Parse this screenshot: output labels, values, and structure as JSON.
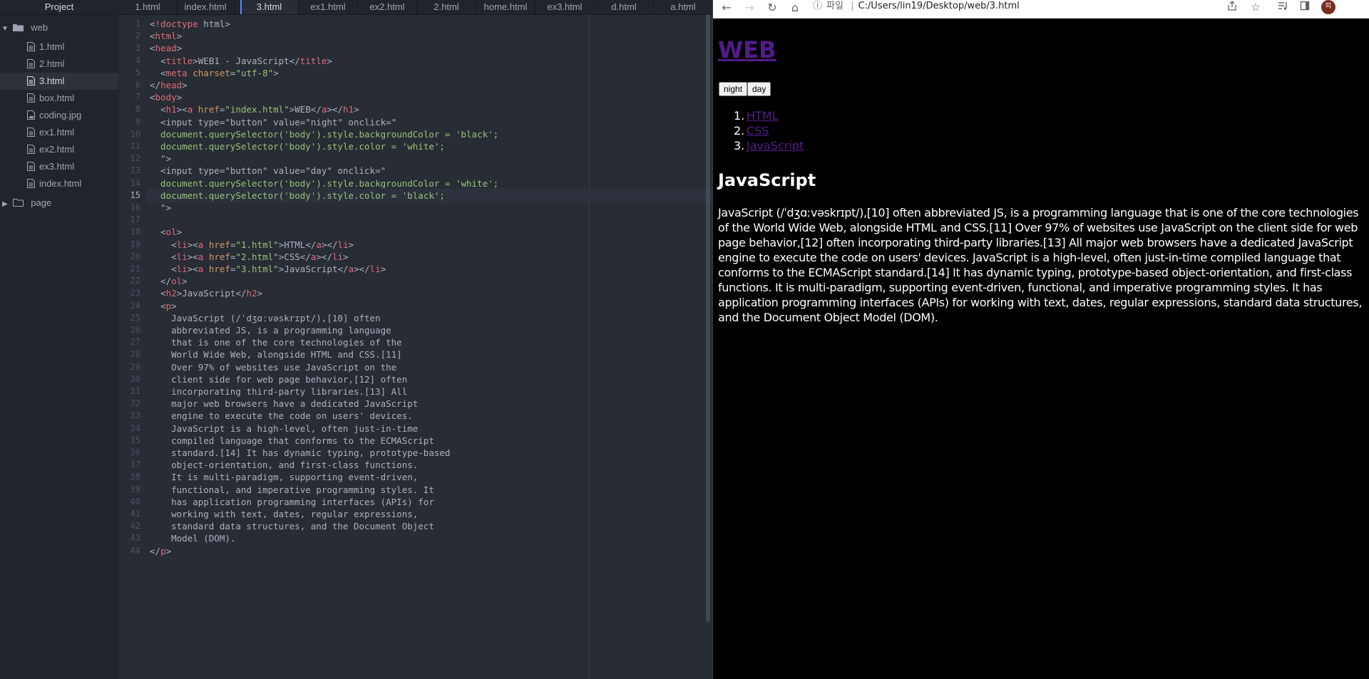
{
  "sidebar": {
    "header": "Project",
    "tree": [
      {
        "label": "web",
        "kind": "folder",
        "expanded": true
      },
      {
        "label": "1.html",
        "kind": "file"
      },
      {
        "label": "2.html",
        "kind": "file"
      },
      {
        "label": "3.html",
        "kind": "file",
        "selected": true
      },
      {
        "label": "box.html",
        "kind": "file"
      },
      {
        "label": "coding.jpg",
        "kind": "image"
      },
      {
        "label": "ex1.html",
        "kind": "file"
      },
      {
        "label": "ex2.html",
        "kind": "file"
      },
      {
        "label": "ex3.html",
        "kind": "file"
      },
      {
        "label": "index.html",
        "kind": "file"
      },
      {
        "label": "page",
        "kind": "folder",
        "expanded": false
      }
    ]
  },
  "editor": {
    "tabs": [
      {
        "label": "1.html"
      },
      {
        "label": "index.html"
      },
      {
        "label": "3.html",
        "active": true
      },
      {
        "label": "ex1.html"
      },
      {
        "label": "ex2.html"
      },
      {
        "label": "2.html"
      },
      {
        "label": "home.html"
      },
      {
        "label": "ex3.html"
      },
      {
        "label": "d.html"
      },
      {
        "label": "a.html"
      }
    ],
    "current_line": 15,
    "lines": [
      "<!doctype html>",
      "<html>",
      "<head>",
      "  <title>WEB1 - JavaScript</title>",
      "  <meta charset=\"utf-8\">",
      "</head>",
      "<body>",
      "  <h1><a href=\"index.html\">WEB</a></h1>",
      "  <input type=\"button\" value=\"night\" onclick=\"",
      "  document.querySelector('body').style.backgroundColor = 'black';",
      "  document.querySelector('body').style.color = 'white';",
      "  \">",
      "  <input type=\"button\" value=\"day\" onclick=\"",
      "  document.querySelector('body').style.backgroundColor = 'white';",
      "  document.querySelector('body').style.color = 'black';",
      "  \">",
      "",
      "  <ol>",
      "    <li><a href=\"1.html\">HTML</a></li>",
      "    <li><a href=\"2.html\">CSS</a></li>",
      "    <li><a href=\"3.html\">JavaScript</a></li>",
      "  </ol>",
      "  <h2>JavaScript</h2>",
      "  <p>",
      "    JavaScript (/ˈdʒɑːvəskrɪpt/),[10] often",
      "    abbreviated JS, is a programming language",
      "    that is one of the core technologies of the",
      "    World Wide Web, alongside HTML and CSS.[11]",
      "    Over 97% of websites use JavaScript on the",
      "    client side for web page behavior,[12] often",
      "    incorporating third-party libraries.[13] All",
      "    major web browsers have a dedicated JavaScript",
      "    engine to execute the code on users' devices.",
      "    JavaScript is a high-level, often just-in-time",
      "    compiled language that conforms to the ECMAScript",
      "    standard.[14] It has dynamic typing, prototype-based",
      "    object-orientation, and first-class functions.",
      "    It is multi-paradigm, supporting event-driven,",
      "    functional, and imperative programming styles. It",
      "    has application programming interfaces (APIs) for",
      "    working with text, dates, regular expressions,",
      "    standard data structures, and the Document Object",
      "    Model (DOM).",
      "</p>"
    ]
  },
  "browser": {
    "toolbar": {
      "back": "←",
      "forward": "→",
      "reload": "↻",
      "home": "⌂",
      "info": "ⓘ",
      "scheme_label": "파일",
      "separator": "|",
      "url": "C:/Users/lin19/Desktop/web/3.html",
      "avatar_text": "띠"
    },
    "page": {
      "h1_link": "WEB",
      "buttons": {
        "night": "night",
        "day": "day"
      },
      "list": [
        {
          "num": "1.",
          "label": "HTML"
        },
        {
          "num": "2.",
          "label": "CSS"
        },
        {
          "num": "3.",
          "label": "JavaScript"
        }
      ],
      "h2": "JavaScript",
      "paragraph": "JavaScript (/ˈdʒɑːvəskrɪpt/),[10] often abbreviated JS, is a programming language that is one of the core technologies of the World Wide Web, alongside HTML and CSS.[11] Over 97% of websites use JavaScript on the client side for web page behavior,[12] often incorporating third-party libraries.[13] All major web browsers have a dedicated JavaScript engine to execute the code on users' devices. JavaScript is a high-level, often just-in-time compiled language that conforms to the ECMAScript standard.[14] It has dynamic typing, prototype-based object-orientation, and first-class functions. It is multi-paradigm, supporting event-driven, functional, and imperative programming styles. It has application programming interfaces (APIs) for working with text, dates, regular expressions, standard data structures, and the Document Object Model (DOM)."
    }
  },
  "colors": {
    "editor_bg": "#282c34",
    "sidebar_bg": "#21252b",
    "tag": "#e06c75",
    "attr": "#d19a66",
    "string": "#98c379",
    "visited_link": "#551a8b"
  }
}
